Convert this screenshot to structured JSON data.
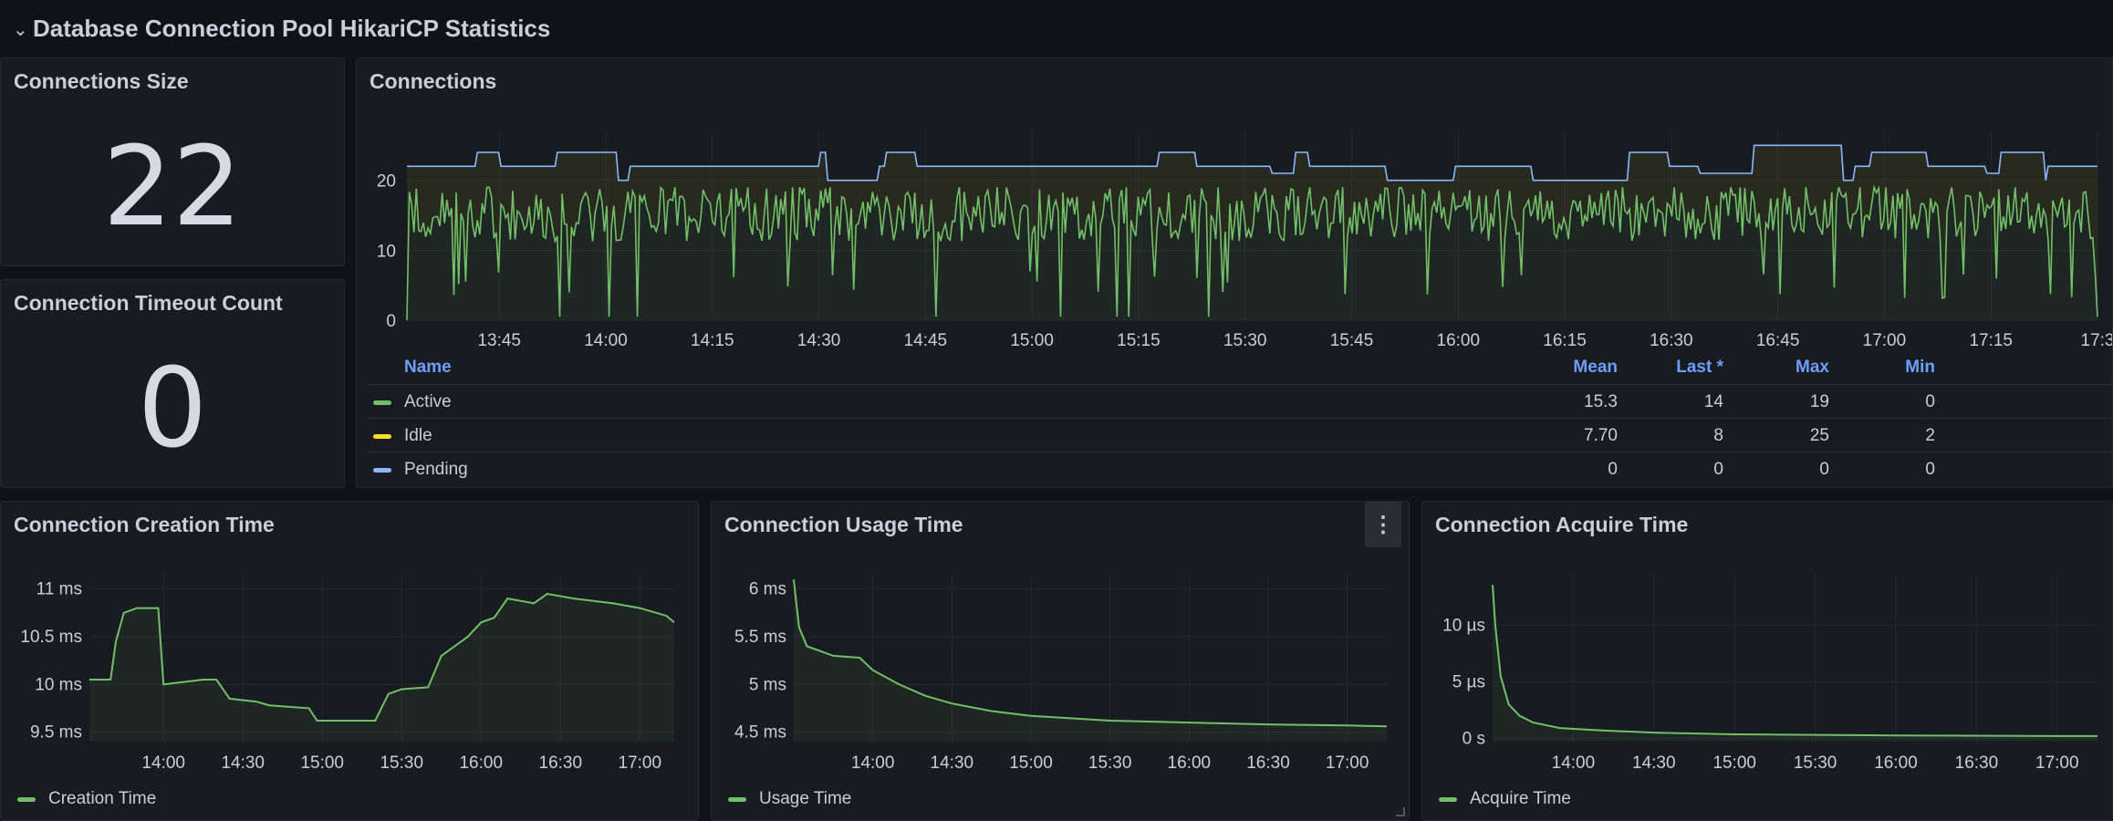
{
  "row": {
    "title": "Database Connection Pool HikariCP Statistics",
    "chevron_icon": "chevron-down-icon"
  },
  "panels": {
    "size": {
      "title": "Connections Size",
      "value": "22"
    },
    "timeout": {
      "title": "Connection Timeout Count",
      "value": "0"
    },
    "connections": {
      "title": "Connections",
      "legend_headers": {
        "name": "Name",
        "mean": "Mean",
        "last": "Last *",
        "max": "Max",
        "min": "Min"
      },
      "legend_rows": [
        {
          "name": "Active",
          "color": "#73bf69",
          "mean": "15.3",
          "last": "14",
          "max": "19",
          "min": "0"
        },
        {
          "name": "Idle",
          "color": "#fade2a",
          "mean": "7.70",
          "last": "8",
          "max": "25",
          "min": "2"
        },
        {
          "name": "Pending",
          "color": "#8ab8ff",
          "mean": "0",
          "last": "0",
          "max": "0",
          "min": "0"
        }
      ]
    },
    "creation": {
      "title": "Connection Creation Time",
      "legend": "Creation Time"
    },
    "usage": {
      "title": "Connection Usage Time",
      "legend": "Usage Time",
      "menu_icon": "kebab-menu-icon"
    },
    "acquire": {
      "title": "Connection Acquire Time",
      "legend": "Acquire Time"
    }
  },
  "colors": {
    "green": "#73bf69",
    "blue": "#8ab8ff",
    "yellow": "#fade2a",
    "grid": "#24272d",
    "text": "#ccccdc"
  },
  "chart_data": [
    {
      "type": "area",
      "title": "Connections",
      "x_ticks": [
        "13:45",
        "14:00",
        "14:15",
        "14:30",
        "14:45",
        "15:00",
        "15:15",
        "15:30",
        "15:45",
        "16:00",
        "16:15",
        "16:30",
        "16:45",
        "17:00",
        "17:15",
        "17:3"
      ],
      "y_ticks": [
        "0",
        "10",
        "20"
      ],
      "ylim": [
        0,
        27
      ],
      "series": [
        {
          "name": "Active",
          "color": "#73bf69",
          "pattern": "noisy",
          "range": [
            0,
            19
          ],
          "typical": 15.3
        },
        {
          "name": "Idle",
          "color": "#fade2a",
          "stacked": true,
          "typical": 7.7
        },
        {
          "name": "Pending",
          "color": "#8ab8ff",
          "total_min": 20,
          "total_max": 25,
          "typical_total": 22
        }
      ]
    },
    {
      "type": "line",
      "title": "Connection Creation Time",
      "x_ticks": [
        "14:00",
        "14:30",
        "15:00",
        "15:30",
        "16:00",
        "16:30",
        "17:00",
        "17:3"
      ],
      "y_ticks": [
        "9.5 ms",
        "10 ms",
        "10.5 ms",
        "11 ms"
      ],
      "ylim": [
        9.4,
        11.15
      ],
      "series": [
        {
          "name": "Creation Time",
          "color": "#73bf69",
          "x": [
            "13:32",
            "13:40",
            "13:42",
            "13:45",
            "13:50",
            "13:55",
            "13:58",
            "14:00",
            "14:15",
            "14:20",
            "14:25",
            "14:35",
            "14:40",
            "14:55",
            "14:58",
            "15:20",
            "15:25",
            "15:30",
            "15:40",
            "15:45",
            "15:55",
            "16:00",
            "16:05",
            "16:10",
            "16:20",
            "16:25",
            "16:35",
            "16:50",
            "17:00",
            "17:10",
            "17:13"
          ],
          "y": [
            10.05,
            10.05,
            10.45,
            10.75,
            10.8,
            10.8,
            10.8,
            10.0,
            10.05,
            10.05,
            9.85,
            9.82,
            9.78,
            9.75,
            9.62,
            9.62,
            9.9,
            9.95,
            9.97,
            10.3,
            10.5,
            10.65,
            10.7,
            10.9,
            10.85,
            10.95,
            10.9,
            10.85,
            10.8,
            10.72,
            10.65
          ]
        }
      ]
    },
    {
      "type": "line",
      "title": "Connection Usage Time",
      "x_ticks": [
        "14:00",
        "14:30",
        "15:00",
        "15:30",
        "16:00",
        "16:30",
        "17:00",
        "17:3"
      ],
      "y_ticks": [
        "4.5 ms",
        "5 ms",
        "5.5 ms",
        "6 ms"
      ],
      "ylim": [
        4.4,
        6.15
      ],
      "series": [
        {
          "name": "Usage Time",
          "color": "#73bf69",
          "x": [
            "13:30",
            "13:32",
            "13:35",
            "13:45",
            "13:55",
            "14:00",
            "14:10",
            "14:20",
            "14:30",
            "14:45",
            "15:00",
            "15:30",
            "16:00",
            "16:30",
            "17:00",
            "17:15"
          ],
          "y": [
            6.1,
            5.6,
            5.4,
            5.3,
            5.28,
            5.15,
            5.0,
            4.88,
            4.8,
            4.72,
            4.67,
            4.62,
            4.6,
            4.58,
            4.57,
            4.56
          ]
        }
      ]
    },
    {
      "type": "line",
      "title": "Connection Acquire Time",
      "x_ticks": [
        "14:00",
        "14:30",
        "15:00",
        "15:30",
        "16:00",
        "16:30",
        "17:00",
        "17:3"
      ],
      "y_ticks": [
        "0 s",
        "5 µs",
        "10 µs"
      ],
      "ylim": [
        -0.3,
        14.5
      ],
      "series": [
        {
          "name": "Acquire Time",
          "color": "#73bf69",
          "x": [
            "13:30",
            "13:31",
            "13:33",
            "13:36",
            "13:40",
            "13:45",
            "13:55",
            "14:10",
            "14:30",
            "15:00",
            "15:30",
            "16:00",
            "17:00",
            "17:15"
          ],
          "y": [
            13.6,
            10.0,
            5.5,
            3.0,
            2.0,
            1.4,
            0.9,
            0.7,
            0.5,
            0.35,
            0.3,
            0.25,
            0.2,
            0.2
          ]
        }
      ]
    }
  ]
}
